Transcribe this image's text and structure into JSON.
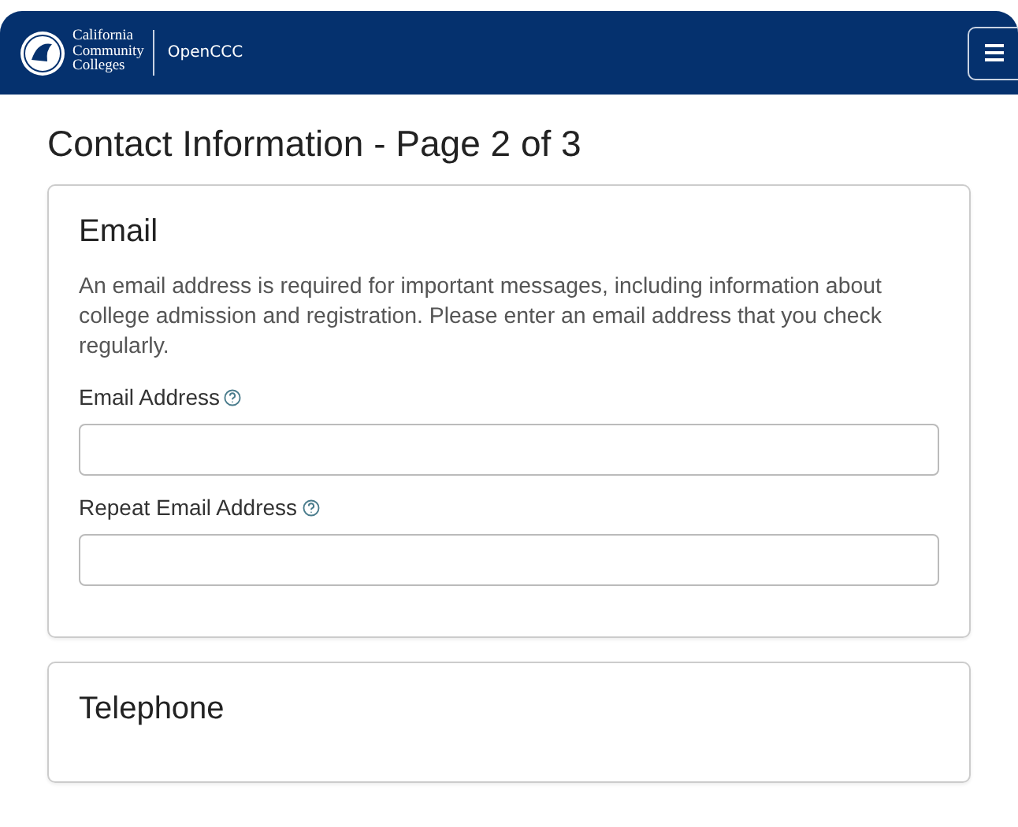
{
  "header": {
    "logo_lines": [
      "California",
      "Community",
      "Colleges"
    ],
    "app_name": "OpenCCC"
  },
  "page_title": "Contact Information - Page 2 of 3",
  "sections": [
    {
      "title": "Email",
      "description": "An email address is required for important messages, including information about college admission and registration. Please enter an email address that you check regularly.",
      "fields": [
        {
          "label": "Email Address",
          "help": true
        },
        {
          "label": "Repeat Email Address",
          "help": true
        }
      ]
    },
    {
      "title": "Telephone"
    }
  ]
}
